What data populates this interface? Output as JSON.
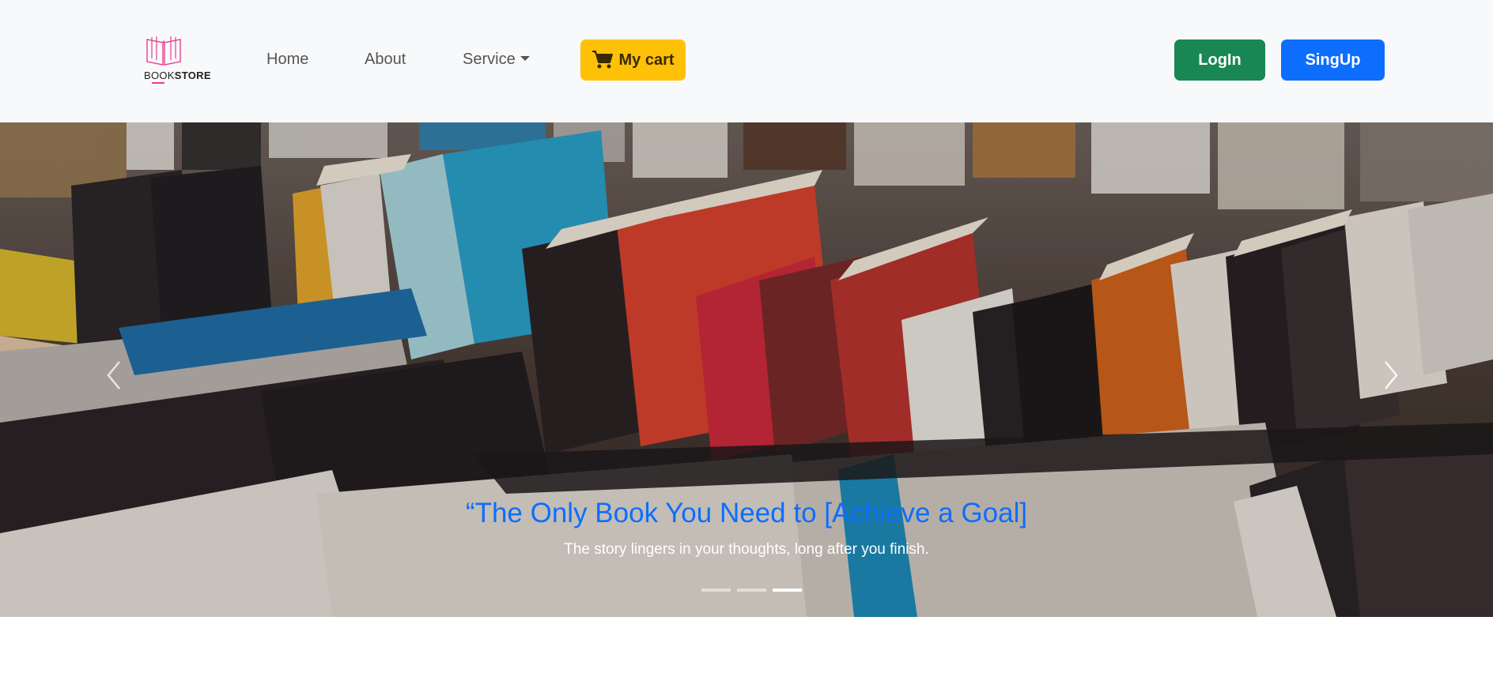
{
  "navbar": {
    "logo": {
      "word_plain": "BOOK",
      "word_bold": "STORE",
      "accent_color": "#e83e8c"
    },
    "links": [
      {
        "label": "Home"
      },
      {
        "label": "About"
      },
      {
        "label": "Service"
      }
    ],
    "cart": {
      "label": "My cart",
      "icon": "cart-icon",
      "color": "#ffc107"
    },
    "login": {
      "label": "LogIn",
      "color": "#198754"
    },
    "signup": {
      "label": "SingUp",
      "color": "#0d6efd"
    }
  },
  "carousel": {
    "slide": {
      "title": "“The Only Book You Need to [Achieve a Goal]",
      "text": "The story lingers in your thoughts, long after you finish.",
      "title_color": "#0d6efd"
    },
    "slide_count": 3,
    "active_slide": 3,
    "prev_icon": "chevron-left-icon",
    "next_icon": "chevron-right-icon"
  }
}
